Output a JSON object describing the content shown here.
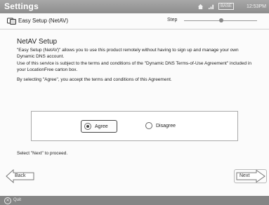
{
  "titlebar": {
    "title": "Settings",
    "base_label": "BASE",
    "time": "12:53PM"
  },
  "crumb": {
    "title": "Easy Setup (NetAV)",
    "step_label": "Step",
    "step_progress": 0.5
  },
  "content": {
    "heading": "NetAV Setup",
    "paragraphs": [
      "\"Easy Setup (NetAV)\" allows you to use this product remotely without having to sign up and manage your own Dynamic DNS account.",
      "Use of this service is subject to the terms and conditions of the \"Dynamic DNS Terms-of-Use Agreement\" included in your LocationFree carton box.",
      "By selecting \"Agree\", you accept the terms and conditions of this Agreement."
    ],
    "options": [
      {
        "label": "Agree",
        "selected": true
      },
      {
        "label": "Disagree",
        "selected": false
      }
    ],
    "proceed_text": "Select \"Next\" to proceed."
  },
  "nav": {
    "back_label": "Back",
    "next_label": "Next"
  },
  "footer": {
    "quit_label": "Quit"
  },
  "icons": [
    "home-icon",
    "network-icon",
    "base-icon",
    "easy-setup-icon",
    "back-arrow-icon",
    "next-arrow-icon",
    "quit-icon"
  ]
}
